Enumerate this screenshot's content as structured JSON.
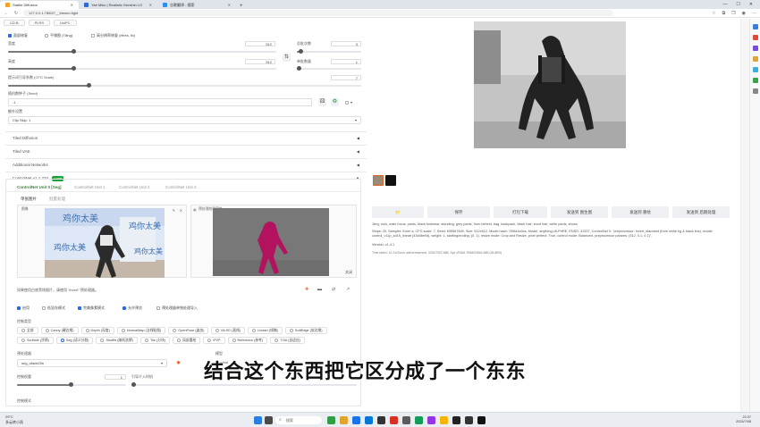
{
  "browser": {
    "tabs": [
      {
        "label": "Stable Diffusion",
        "active": true
      },
      {
        "label": "Yae Miko | Realistic Genshin LO",
        "active": false
      },
      {
        "label": "谷歌翻译 - 搜索",
        "active": false
      }
    ],
    "url": "127.0.0.1:7860/?__theme=light"
  },
  "top_models": [
    "CD.B",
    "PLRS",
    "UniPC"
  ],
  "left": {
    "checks_top": [
      {
        "label": "面部修复",
        "on": true
      },
      {
        "label": "平铺图 (Tiling)",
        "on": false
      },
      {
        "label": "高分辨率修复 (Hires. fix)",
        "on": false
      }
    ],
    "width_label": "宽度",
    "width_value": "512",
    "height_label": "高度",
    "height_value": "512",
    "batch_count_label": "总批次数",
    "batch_count_value": "3",
    "batch_size_label": "单批数量",
    "batch_size_value": "1",
    "cfg_label": "提示词引导系数 (CFG Scale)",
    "cfg_value": "7",
    "seed_label": "随机数种子 (Seed)",
    "seed_value": "-1",
    "extra_label": "额外设置",
    "clip_value": "Clip Skip: 1",
    "accordions": [
      "Tiled Diffusion",
      "Tiled VAE",
      "Additional Networks"
    ],
    "controlnet_title": "ControlNet v1.1.233",
    "controlnet_badge": "1 unit",
    "units": [
      "ControlNet Unit 0 [Seg]",
      "ControlNet Unit 1",
      "ControlNet Unit 2",
      "ControlNet Unit 3"
    ],
    "subtabs": [
      "单张图片",
      "批量处理"
    ],
    "image_caption": "图像",
    "preprocess_caption": "预处理结果预览",
    "preview_close": "关闭",
    "hint": "如果使用白底黑线图片，请使用 \"invert\" 预处理器。",
    "cn_checks": [
      {
        "label": "启用",
        "on": true
      },
      {
        "label": "低显存模式",
        "on": false
      },
      {
        "label": "完美像素模式",
        "on": true
      },
      {
        "label": "允许预览",
        "on": true
      },
      {
        "label": "预处理器单独处理导入",
        "on": false
      }
    ],
    "control_type_label": "控制类型",
    "control_types": [
      {
        "label": "全部",
        "on": false
      },
      {
        "label": "Canny (硬边缘)",
        "on": false
      },
      {
        "label": "Depth (深度)",
        "on": false
      },
      {
        "label": "NormalMap (法线贴图)",
        "on": false
      },
      {
        "label": "OpenPose (姿态)",
        "on": false
      },
      {
        "label": "MLSD (直线)",
        "on": false
      },
      {
        "label": "Lineart (线稿)",
        "on": false
      },
      {
        "label": "SoftEdge (软边缘)",
        "on": false
      },
      {
        "label": "Scribble (涂鸦)",
        "on": false
      },
      {
        "label": "Seg (语义分割)",
        "on": true
      },
      {
        "label": "Shuffle (随机洗牌)",
        "on": false
      },
      {
        "label": "Tile (分块)",
        "on": false
      },
      {
        "label": "局部重绘",
        "on": false
      },
      {
        "label": "IP2P",
        "on": false
      },
      {
        "label": "Reference (参考)",
        "on": false
      },
      {
        "label": "T2IA (自适应)",
        "on": false
      }
    ],
    "preprocessor_label": "预处理器",
    "preprocessor_value": "seg_ofade20k",
    "model_label": "模型",
    "model_value": "control",
    "weight_label": "控制权重",
    "weight_value": "1",
    "start_label": "引导介入时机",
    "mode_label": "控制模式",
    "watermark_a": "鸡你太美",
    "watermark_b": "鸡你太美",
    "watermark_c": "鸡你太美",
    "watermark_d": "鸡你太美"
  },
  "right": {
    "buttons": [
      "📁",
      "保存",
      "打包下载",
      "发送到 图生图",
      "发送到 重绘",
      "发送到 后期处理"
    ],
    "info_lines": [
      "1boy, solo, male focus, pants, black footwear, standing, grey pants, from behind, bag, backpack, black hair, short hair, white pants, shoes",
      "Steps: 20, Sampler: Euler a, CFG scale: 7, Seed: 695567849, Size: 512x512, Model hash: 7f96a1a9ca, Model: anything-v5-PrtRE, ENSD: 31337, ControlNet 0: \"preprocessor: Invert_standard (from white bg & black line), model: control_v11p_sd15_lineart [43d4be0d], weight: 1, starting/ending: (0, 1), resize mode: Crop and Resize, pixel perfect: True, control mode: Balanced, preprocessor params: (512, 0.1, 0.1)\",",
      "Version: v1.4.1",
      "Time taken: 12.21sTorch active/reserved: 3232/7302 MiB, Sys VRAM: 9058/24564 MiB (36.88%)"
    ]
  },
  "subtitle": "结合这个东西把它区分成了一个东东",
  "taskbar": {
    "weather_top": "29°C",
    "weather_bottom": "多云转小雨",
    "search_placeholder": "搜索",
    "time": "22:37",
    "date": "2023/7/08"
  },
  "colors": {
    "accent": "#2a6be0",
    "enabled_badge": "#1e9e3a",
    "seg_magenta": "#b3135e"
  }
}
